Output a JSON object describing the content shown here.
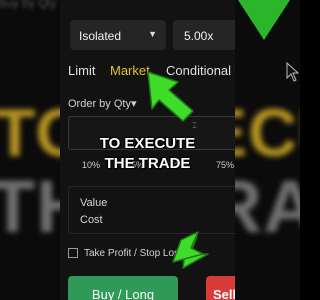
{
  "background": {
    "header_text": "Buy by Qty",
    "word1": "TO EXECUTE",
    "word2": "THE TRADE"
  },
  "margin_mode": {
    "value": "Isolated",
    "icon": "chevron-down-icon"
  },
  "leverage": {
    "value": "5.00x"
  },
  "order_tabs": {
    "limit": "Limit",
    "market": "Market",
    "conditional": "Conditional ▾",
    "active": "Market"
  },
  "order_by": {
    "label": "Order by Qty▾"
  },
  "quantity_input": {
    "value": "",
    "placeholder": ""
  },
  "slider_ticks": [
    "10%",
    "25%",
    "50%",
    "75%"
  ],
  "info": {
    "value_label": "Value",
    "cost_label": "Cost"
  },
  "take_profit": {
    "label": "Take Profit / Stop Loss",
    "checked": false
  },
  "buttons": {
    "buy": "Buy / Long",
    "sell": "Sell"
  },
  "overlay": {
    "caption_line1": "TO EXECUTE",
    "caption_line2": "THE TRADE"
  },
  "colors": {
    "accent_yellow": "#e2c12a",
    "buy_green": "#2f9a57",
    "sell_red": "#d93a3a",
    "arrow_green": "#3fdc2a"
  }
}
